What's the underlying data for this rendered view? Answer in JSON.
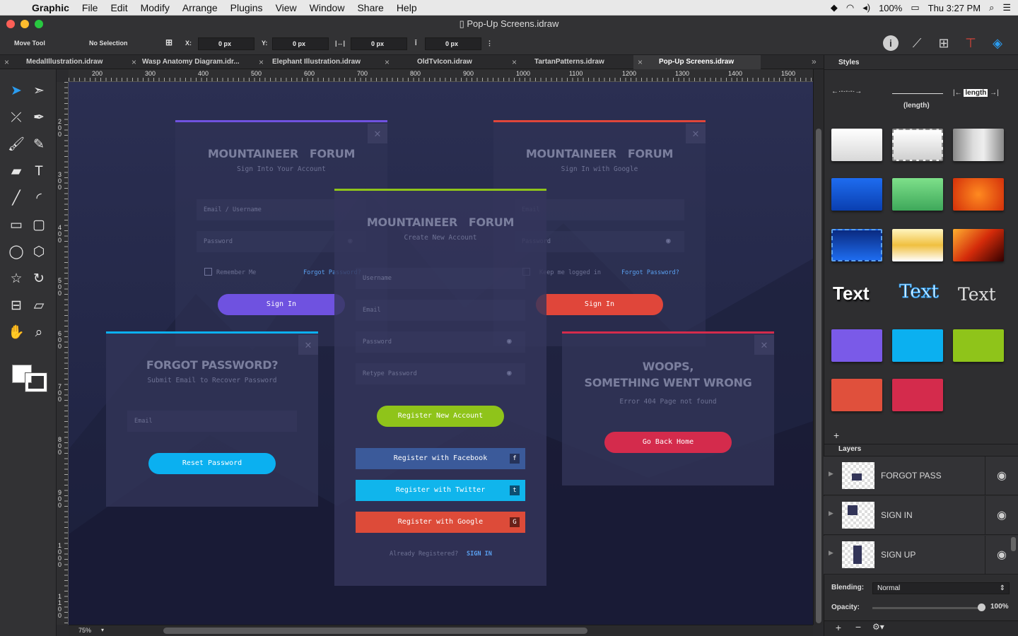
{
  "menubar": {
    "app": "Graphic",
    "items": [
      "File",
      "Edit",
      "Modify",
      "Arrange",
      "Plugins",
      "View",
      "Window",
      "Share",
      "Help"
    ],
    "battery": "100%",
    "clock": "Thu 3:27 PM"
  },
  "window": {
    "title": "Pop-Up Screens.idraw"
  },
  "toolbar": {
    "tool_name": "Move Tool",
    "selection": "No Selection",
    "x_label": "X:",
    "x_value": "0 px",
    "y_label": "Y:",
    "y_value": "0 px",
    "w_value": "0 px",
    "h_value": "0 px"
  },
  "tabs": [
    "MedalIllustration.idraw",
    "Wasp Anatomy Diagram.idr...",
    "Elephant Illustration.idraw",
    "OldTvIcon.idraw",
    "TartanPatterns.idraw",
    "Pop-Up Screens.idraw"
  ],
  "ruler_h": [
    "200",
    "300",
    "400",
    "500",
    "600",
    "700",
    "800",
    "900",
    "1000",
    "1100",
    "1200",
    "1300",
    "1400",
    "1500"
  ],
  "ruler_v": [
    "200",
    "300",
    "400",
    "500",
    "600",
    "700",
    "800",
    "900",
    "1000",
    "1100"
  ],
  "zoom": "75%",
  "cards": {
    "signin": {
      "title1": "MOUNTAINEER",
      "title2": "FORUM",
      "subtitle": "Sign Into Your Account",
      "email": "Email / Username",
      "password": "Password",
      "remember": "Remember Me",
      "forgot": "Forgot Password?",
      "button": "Sign In",
      "close": "✕"
    },
    "google": {
      "title1": "MOUNTAINEER",
      "title2": "FORUM",
      "subtitle": "Sign In with Google",
      "email": "Email",
      "password": "Password",
      "keep": "Keep me logged in",
      "forgot": "Forgot Password?",
      "button": "Sign In",
      "close": "✕"
    },
    "register": {
      "title1": "MOUNTAINEER",
      "title2": "FORUM",
      "subtitle": "Create New Account",
      "username": "Username",
      "email": "Email",
      "password": "Password",
      "retype": "Retype Password",
      "button": "Register New Account",
      "facebook": "Register with Facebook",
      "twitter": "Register with Twitter",
      "googlebtn": "Register with Google",
      "already": "Already Registered?",
      "signin": "SIGN IN"
    },
    "forgot": {
      "title": "FORGOT PASSWORD?",
      "subtitle": "Submit Email to Recover Password",
      "email": "Email",
      "button": "Reset Password",
      "close": "✕"
    },
    "error": {
      "title1": "WOOPS,",
      "title2": "SOMETHING WENT WRONG",
      "subtitle": "Error 404 Page not found",
      "button": "Go Back Home",
      "close": "✕"
    }
  },
  "styles_panel": {
    "title": "Styles",
    "length_caption": "(length)",
    "length_label": "length",
    "text_samples": [
      "Text",
      "Text",
      "Text"
    ],
    "add": "+"
  },
  "layers_panel": {
    "title": "Layers",
    "layers": [
      {
        "name": "FORGOT PASS"
      },
      {
        "name": "SIGN IN"
      },
      {
        "name": "SIGN UP"
      }
    ]
  },
  "blending": {
    "label": "Blending:",
    "value": "Normal"
  },
  "opacity": {
    "label": "Opacity:",
    "value": "100%",
    "level": 1.0
  },
  "colors": {
    "purple": "#6f52e0",
    "red": "#e0463a",
    "green": "#8fc41a",
    "blue": "#0bb0f0",
    "crimson": "#d42b4c",
    "facebook": "#3b5a9a",
    "twitter": "#10b5ec",
    "google": "#dd4b39"
  }
}
